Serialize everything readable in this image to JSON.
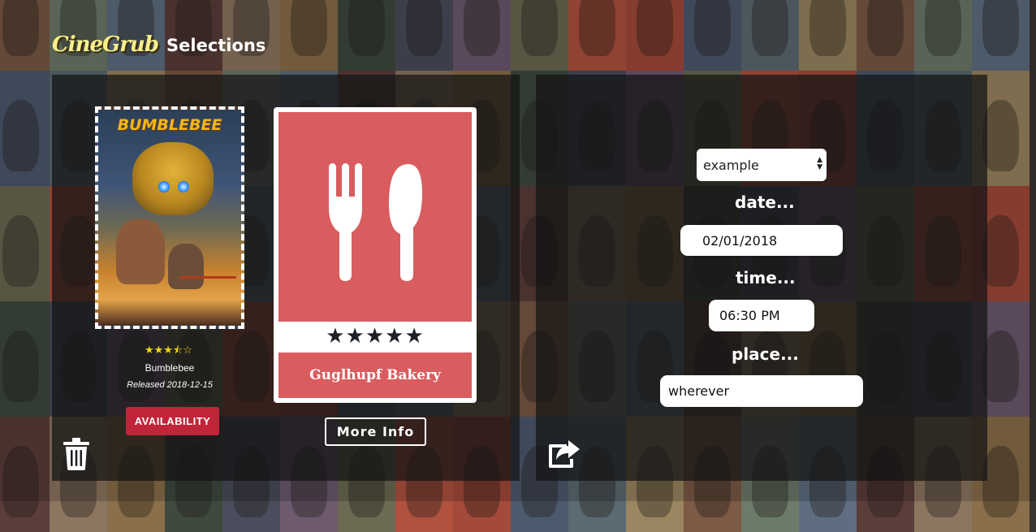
{
  "header": {
    "logo_text": "CineGrub",
    "title": "Selections"
  },
  "movie": {
    "poster_title": "BUMBLEBEE",
    "rating_stars": "★★★⯪☆",
    "rating_value": 3.5,
    "rating_max": 5,
    "title": "Bumblebee",
    "released": "Released 2018-12-15",
    "availability_label": "AVAILABILITY"
  },
  "restaurant": {
    "icon": "fork-knife-icon",
    "rating_stars": "★★★★★",
    "rating_value": 5,
    "rating_max": 5,
    "name": "Guglhupf Bakery",
    "more_info_label": "More Info"
  },
  "plan": {
    "select_value": "example",
    "date_label": "date...",
    "date_value": "02/01/2018",
    "time_label": "time...",
    "time_value": "06:30 PM",
    "place_label": "place...",
    "place_value": "wherever"
  },
  "icons": {
    "delete": "trash-icon",
    "share": "share-icon"
  },
  "colors": {
    "accent_red": "#d95c5e",
    "availability_red": "#c0253a",
    "logo_yellow": "#f6f08a",
    "star_yellow": "#f2d31a"
  }
}
